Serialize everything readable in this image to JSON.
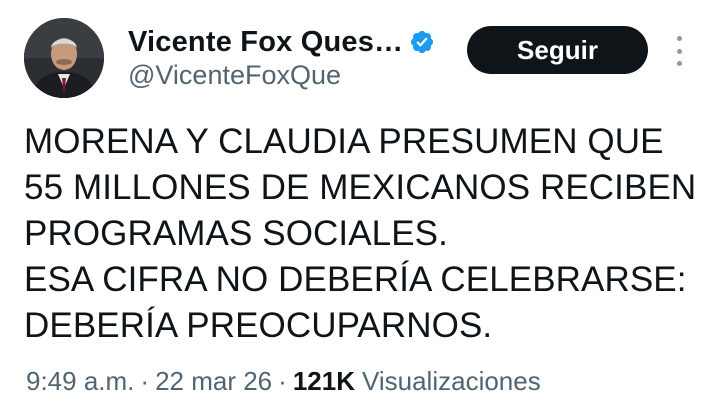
{
  "author": {
    "display_name": "Vicente Fox Ques…",
    "handle": "@VicenteFoxQue",
    "verified": true
  },
  "actions": {
    "follow_label": "Seguir"
  },
  "tweet": {
    "lines": [
      "MORENA Y CLAUDIA PRESUMEN QUE",
      "55 MILLONES DE MEXICANOS RECIBEN",
      "PROGRAMAS SOCIALES.",
      "ESA CIFRA NO DEBERÍA CELEBRARSE:",
      "DEBERÍA PREOCUPARNOS."
    ]
  },
  "meta": {
    "time": "9:49 a.m.",
    "separator": "·",
    "date": "22 mar 26",
    "views_count": "121K",
    "views_label": "Visualizaciones"
  },
  "colors": {
    "verified_badge": "#1d9bf0",
    "follow_button_bg": "#0f1419",
    "secondary_text": "#536471"
  },
  "icons": {
    "verified": "verified-badge-icon",
    "more": "more-options-icon"
  }
}
